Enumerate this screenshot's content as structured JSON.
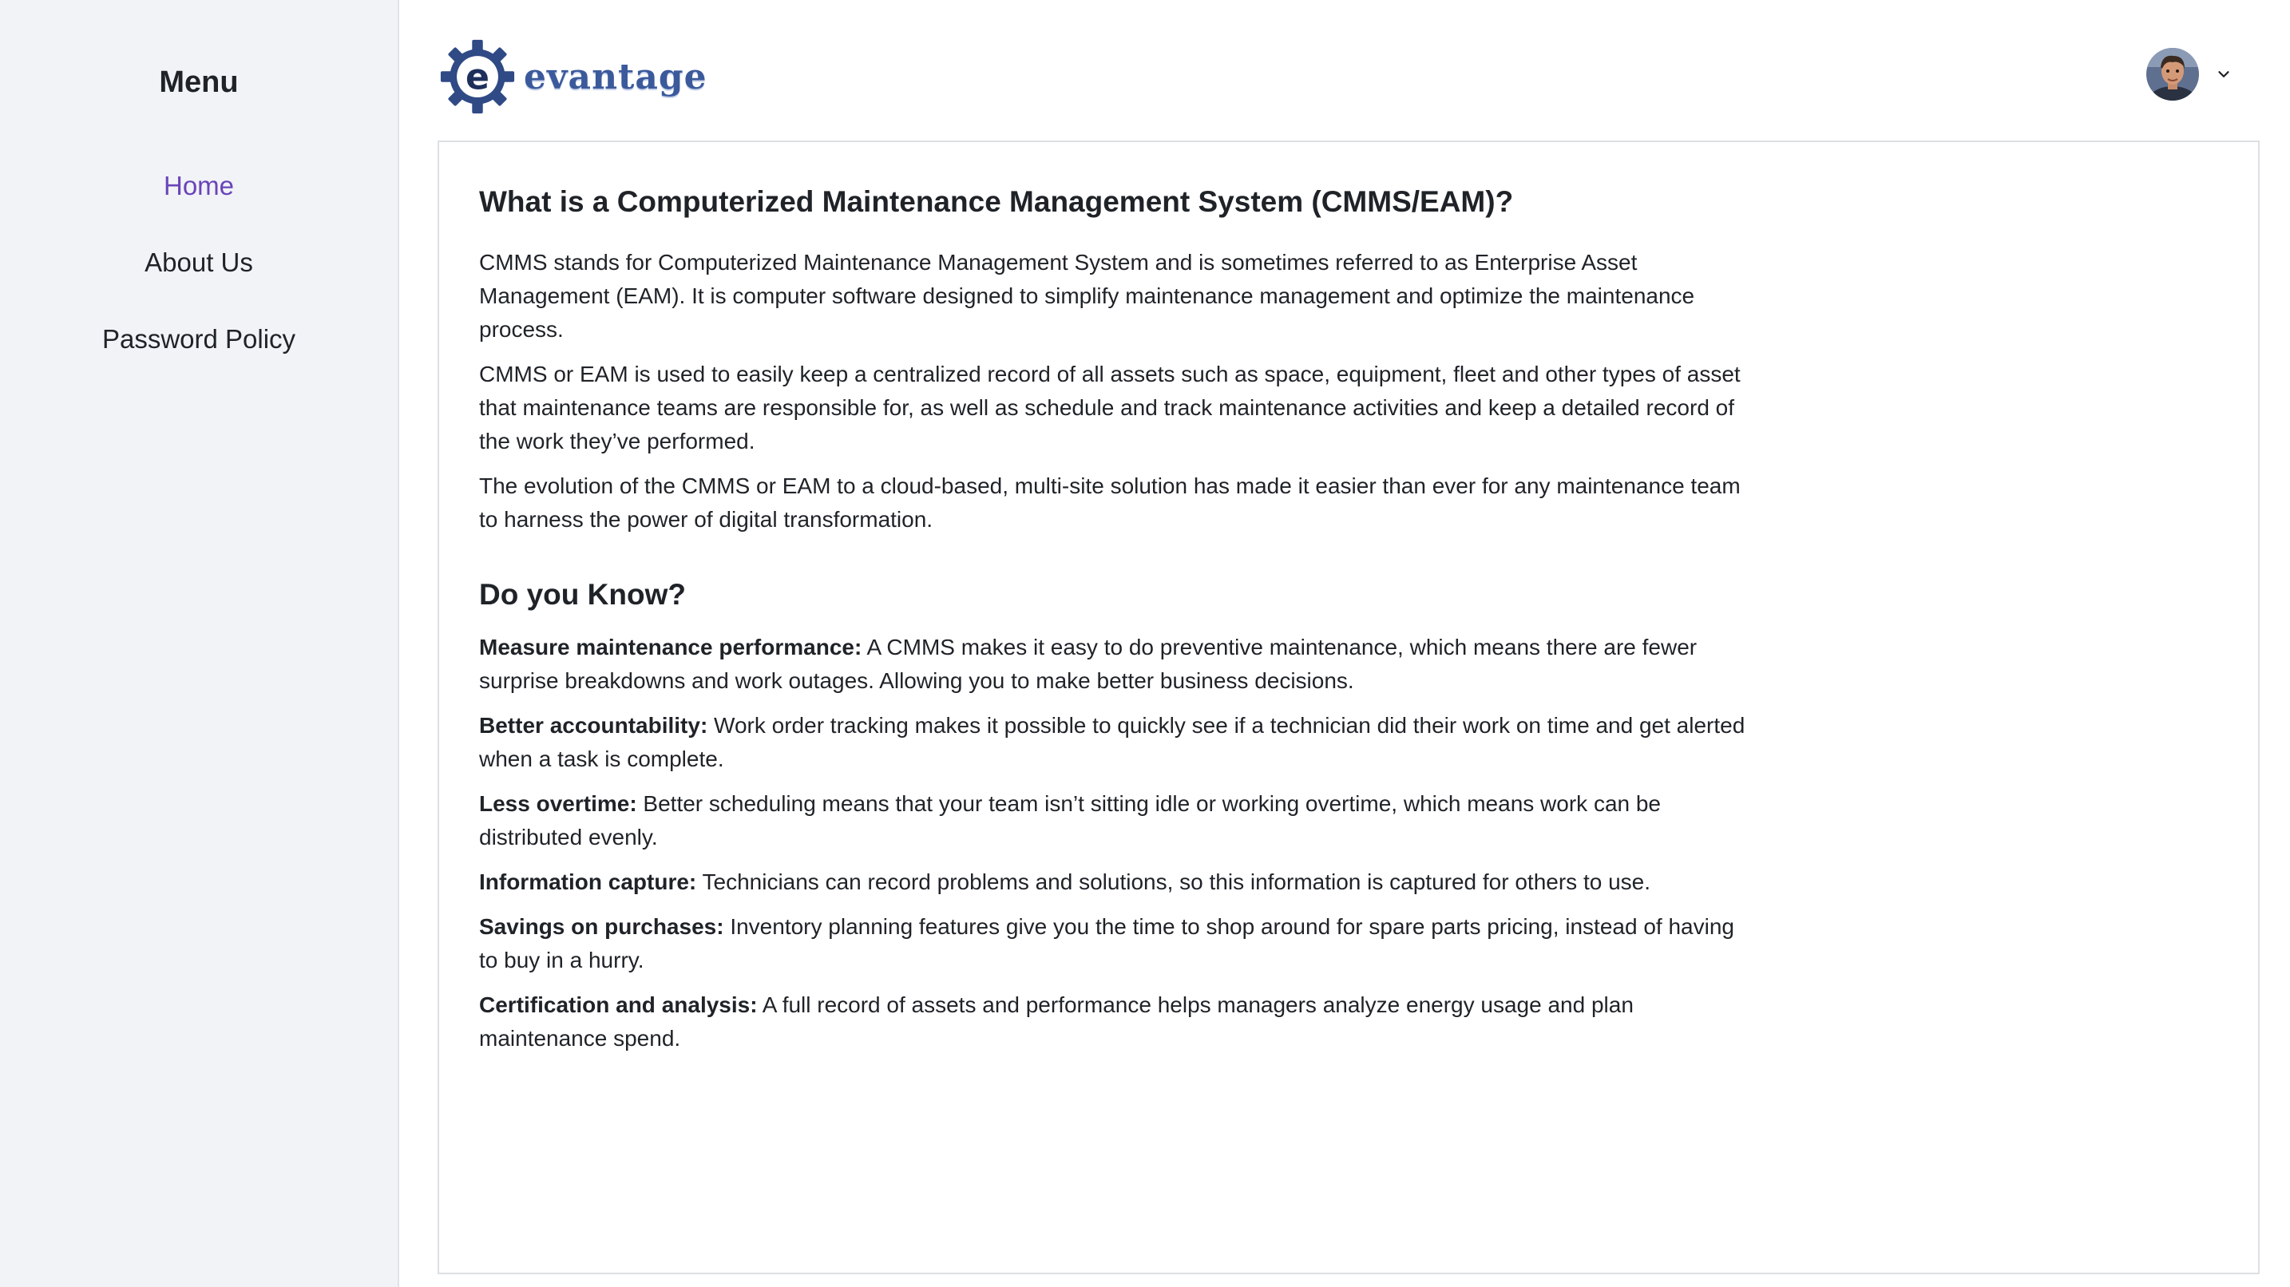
{
  "sidebar": {
    "title": "Menu",
    "items": [
      {
        "label": "Home",
        "active": true
      },
      {
        "label": "About Us",
        "active": false
      },
      {
        "label": "Password Policy",
        "active": false
      }
    ]
  },
  "header": {
    "logo_text": "evantage",
    "avatar_icon": "user-avatar",
    "menu_icon": "chevron-down-icon"
  },
  "main": {
    "title": "What is a Computerized Maintenance Management System (CMMS/EAM)?",
    "paragraphs": [
      "CMMS stands for Computerized Maintenance Management System and is sometimes referred to as Enterprise Asset Management (EAM). It is computer software designed to simplify maintenance management and optimize the maintenance process.",
      "CMMS or EAM is used to easily keep a centralized record of all assets such as space, equipment, fleet and other types of asset that maintenance teams are responsible for, as well as schedule and track maintenance activities and keep a detailed record of the work they’ve performed.",
      "The evolution of the CMMS or EAM to a cloud-based, multi-site solution has made it easier than ever for any maintenance team to harness the power of digital transformation."
    ],
    "subtitle": "Do you Know?",
    "facts": [
      {
        "term": "Measure maintenance performance:",
        "text": " A CMMS makes it easy to do preventive maintenance, which means there are fewer surprise breakdowns and work outages. Allowing you to make better business decisions."
      },
      {
        "term": "Better accountability:",
        "text": " Work order tracking makes it possible to quickly see if a technician did their work on time and get alerted when a task is complete."
      },
      {
        "term": "Less overtime:",
        "text": " Better scheduling means that your team isn’t sitting idle or working overtime, which means work can be distributed evenly."
      },
      {
        "term": "Information capture:",
        "text": " Technicians can record problems and solutions, so this information is captured for others to use."
      },
      {
        "term": "Savings on purchases:",
        "text": " Inventory planning features give you the time to shop around for spare parts pricing, instead of having to buy in a hurry."
      },
      {
        "term": "Certification and analysis:",
        "text": " A full record of assets and performance helps managers analyze energy usage and plan maintenance spend."
      }
    ]
  },
  "colors": {
    "sidebar_bg": "#f1f3f7",
    "active_nav": "#6a44b8",
    "logo_gear": "#2f4a85",
    "logo_text": "#3b5a9b"
  }
}
